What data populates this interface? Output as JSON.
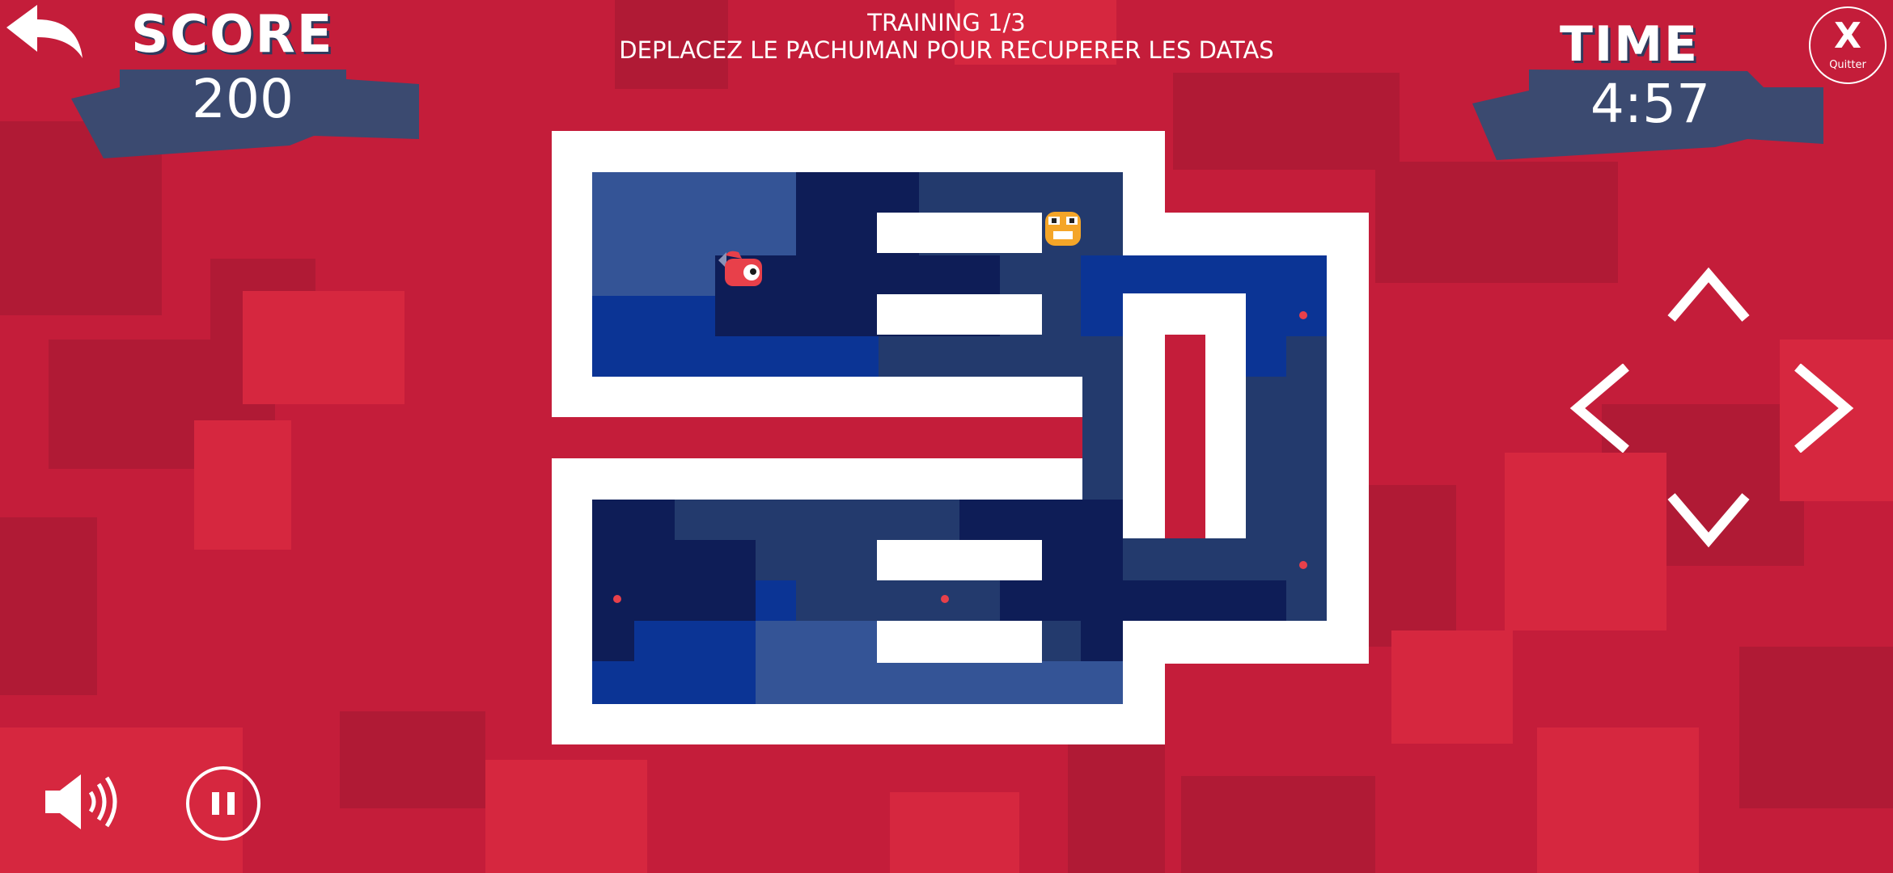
{
  "hud": {
    "score_label": "SCORE",
    "score_value": "200",
    "time_label": "TIME",
    "time_value": "4:57",
    "quit_label": "Quitter",
    "quit_mark": "X"
  },
  "instructions": {
    "line1": "TRAINING 1/3",
    "line2": "DEPLACEZ LE PACHUMAN POUR RECUPERER LES DATAS"
  },
  "colors": {
    "background": "#c41d3a",
    "banner": "#3b4a70",
    "maze_wall": "#ffffff",
    "tile_light": "#345496",
    "tile_mid": "#233a6d",
    "tile_dark": "#0e1d57",
    "tile_bright": "#0b3495",
    "data_dot": "#e8404a"
  },
  "icons": {
    "back": "back-arrow-icon",
    "sound": "speaker-icon",
    "pause": "pause-icon",
    "up": "arrow-up-icon",
    "down": "arrow-down-icon",
    "left": "arrow-left-icon",
    "right": "arrow-right-icon",
    "player": "pachuman-character-icon",
    "enemy": "ghost-enemy-icon"
  }
}
